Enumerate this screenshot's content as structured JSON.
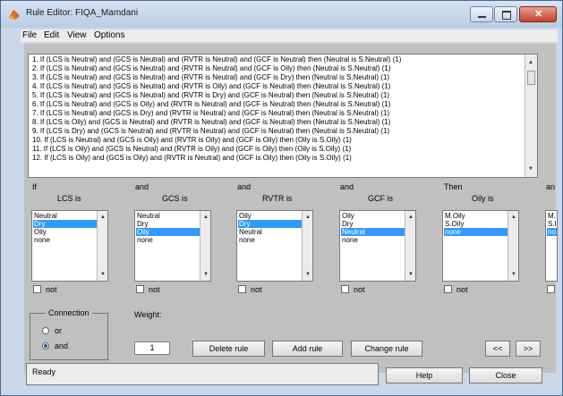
{
  "window": {
    "title": "Rule Editor: FIQA_Mamdani"
  },
  "menu": [
    "File",
    "Edit",
    "View",
    "Options"
  ],
  "rules": [
    "1. If (LCS is Neutral) and (GCS is Neutral) and (RVTR is Neutral) and (GCF is Neutral) then (Neutral is S.Neutral) (1)",
    "2. If (LCS is Neutral) and (GCS is Neutral) and (RVTR is Neutral) and (GCF is Oily) then (Neutral is S.Neutral) (1)",
    "3. If (LCS is Neutral) and (GCS is Neutral) and (RVTR is Neutral) and (GCF is Dry) then (Neutral is S.Neutral) (1)",
    "4. If (LCS is Neutral) and (GCS is Neutral) and (RVTR is Oily) and (GCF is Neutral) then (Neutral is S.Neutral) (1)",
    "5. If (LCS is Neutral) and (GCS is Neutral) and (RVTR is Dry) and (GCF is Neutral) then (Neutral is S.Neutral) (1)",
    "6. If (LCS is Neutral) and (GCS is Oily) and (RVTR is Neutral) and (GCF is Neutral) then (Neutral is S.Neutral) (1)",
    "7. If (LCS is Neutral) and (GCS is Dry) and (RVTR is Neutral) and (GCF is Neutral) then (Neutral is S.Neutral) (1)",
    "8. If (LCS is Oily) and (GCS is Neutral) and (RVTR is Neutral) and (GCF is Neutral) then (Neutral is S.Neutral) (1)",
    "9. If (LCS is Dry) and (GCS is Neutral) and (RVTR is Neutral) and (GCF is Neutral) then (Neutral is S.Neutral) (1)",
    "10. If (LCS is Neutral) and (GCS is Oily) and (RVTR is Oily) and (GCF is Oily) then (Oily is S.Oily) (1)",
    "11. If (LCS is Oily) and (GCS is Neutral) and (RVTR is Oily) and (GCF is Oily) then (Oily is S.Oily) (1)",
    "12. If (LCS is Oily) and (GCS is Oily) and (RVTR is Neutral) and (GCF is Oily) then (Oily is S.Oily) (1)"
  ],
  "columns": [
    {
      "connector": "If",
      "header": "LCS is",
      "items": [
        "Neutral",
        "Dry",
        "Oily",
        "none"
      ],
      "selected": 1,
      "not_label": "not"
    },
    {
      "connector": "and",
      "header": "GCS is",
      "items": [
        "Neutral",
        "Dry",
        "Oily",
        "none"
      ],
      "selected": 2,
      "not_label": "not"
    },
    {
      "connector": "and",
      "header": "RVTR is",
      "items": [
        "Oily",
        "Dry",
        "Neutral",
        "none"
      ],
      "selected": 1,
      "not_label": "not"
    },
    {
      "connector": "and",
      "header": "GCF is",
      "items": [
        "Oily",
        "Dry",
        "Neutral",
        "none"
      ],
      "selected": 2,
      "not_label": "not"
    },
    {
      "connector": "Then",
      "header": "Oily is",
      "items": [
        "M.Oily",
        "S.Oily",
        "none"
      ],
      "selected": 2,
      "not_label": "not"
    },
    {
      "connector": "an",
      "header": "",
      "items": [
        "M.",
        "S.I",
        "no"
      ],
      "selected": 2,
      "not_label": ""
    }
  ],
  "connection": {
    "label": "Connection",
    "options": [
      "or",
      "and"
    ],
    "selected": "and"
  },
  "weight": {
    "label": "Weight:",
    "value": "1"
  },
  "buttons": {
    "delete_rule": "Delete rule",
    "add_rule": "Add rule",
    "change_rule": "Change rule",
    "prev": "<<",
    "next": ">>",
    "help": "Help",
    "close": "Close"
  },
  "status": "Ready"
}
